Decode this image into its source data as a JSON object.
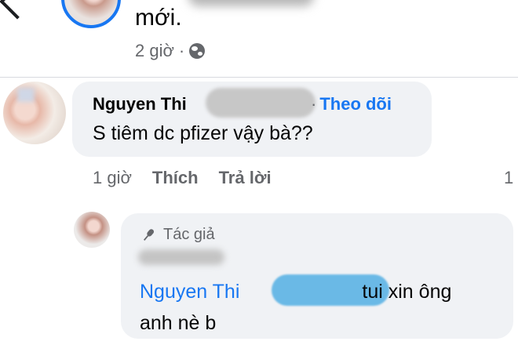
{
  "top_post": {
    "text": "mới.",
    "time": "2 giờ",
    "separator": "·",
    "privacy_icon": "globe-icon"
  },
  "comment": {
    "author_visible": "Nguyen Thi",
    "follow_separator": "·",
    "follow_label": "Theo dõi",
    "text": "S tiêm dc pfizer vậy bà??",
    "time": "1 giờ",
    "like_label": "Thích",
    "reply_label": "Trả lời",
    "reply_count": "1"
  },
  "reply": {
    "badge_icon": "microphone-icon",
    "badge_label": "Tác giả",
    "mention_visible": "Nguyen Thi",
    "text_after_mention": "tui xin ông",
    "text_line2": "anh nè b"
  },
  "colors": {
    "accent": "#1877f2",
    "bubble": "#f0f2f5",
    "secondary_text": "#65676b",
    "redaction_blue": "#6ab9e6"
  }
}
